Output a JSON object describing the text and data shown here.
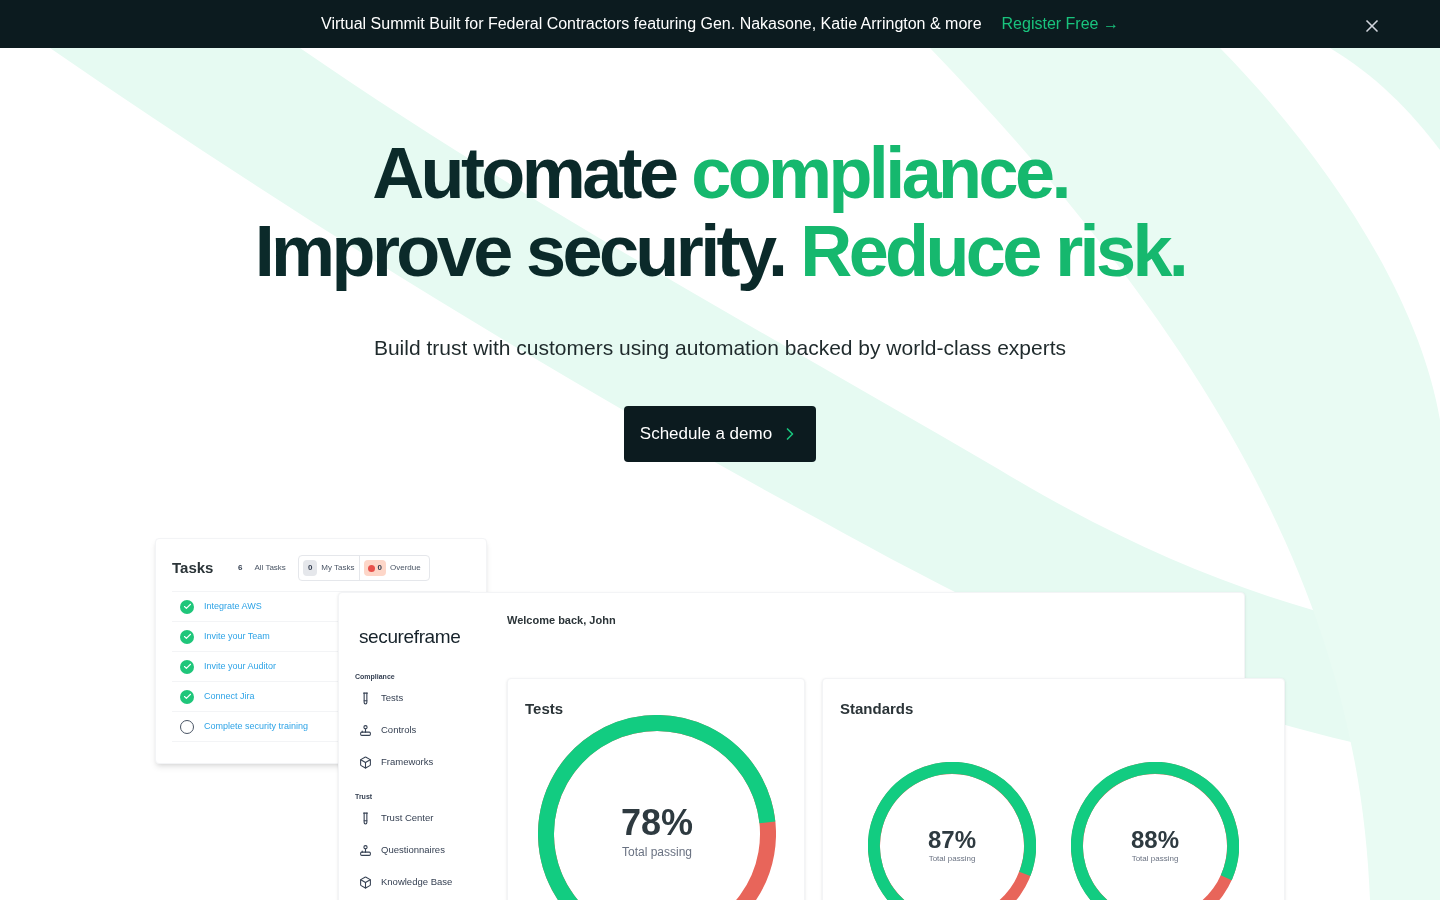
{
  "banner": {
    "text": "Virtual Summit Built for Federal Contractors featuring Gen. Nakasone, Katie Arrington & more",
    "link": "Register Free →"
  },
  "headline": {
    "lines": [
      [
        {
          "text": "Automate",
          "accent": false
        },
        {
          "text": "compliance.",
          "accent": true
        }
      ],
      [
        {
          "text": "Improve security.",
          "accent": false
        },
        {
          "text": "Reduce risk.",
          "accent": true
        }
      ]
    ]
  },
  "subtitle": "Build trust with customers using automation backed by world-class experts",
  "cta": {
    "label": "Schedule a demo"
  },
  "tasks": {
    "title": "Tasks",
    "all_count": "6",
    "all_label": "All Tasks",
    "my_count": "0",
    "my_label": "My Tasks",
    "overdue_count": "0",
    "overdue_label": "Overdue",
    "items": [
      {
        "label": "Integrate AWS",
        "done": true
      },
      {
        "label": "Invite your Team",
        "done": true
      },
      {
        "label": "Invite your Auditor",
        "done": true
      },
      {
        "label": "Connect Jira",
        "done": true
      },
      {
        "label": "Complete security training",
        "done": false
      }
    ]
  },
  "dashboard": {
    "logo": "secureframe",
    "welcome": "Welcome back, John",
    "sidebar": [
      {
        "heading": "Compliance",
        "items": [
          {
            "label": "Tests",
            "kind": "tube"
          },
          {
            "label": "Controls",
            "kind": "joystick"
          },
          {
            "label": "Frameworks",
            "kind": "box"
          }
        ]
      },
      {
        "heading": "Trust",
        "items": [
          {
            "label": "Trust Center",
            "kind": "tube"
          },
          {
            "label": "Questionnaires",
            "kind": "joystick"
          },
          {
            "label": "Knowledge Base",
            "kind": "box"
          }
        ]
      }
    ],
    "tests": {
      "title": "Tests",
      "value": "78%",
      "caption": "Total passing"
    },
    "standards": {
      "title": "Standards",
      "gauges": [
        {
          "value": "87%",
          "caption": "Total passing"
        },
        {
          "value": "88%",
          "caption": "Total passing"
        }
      ]
    }
  }
}
